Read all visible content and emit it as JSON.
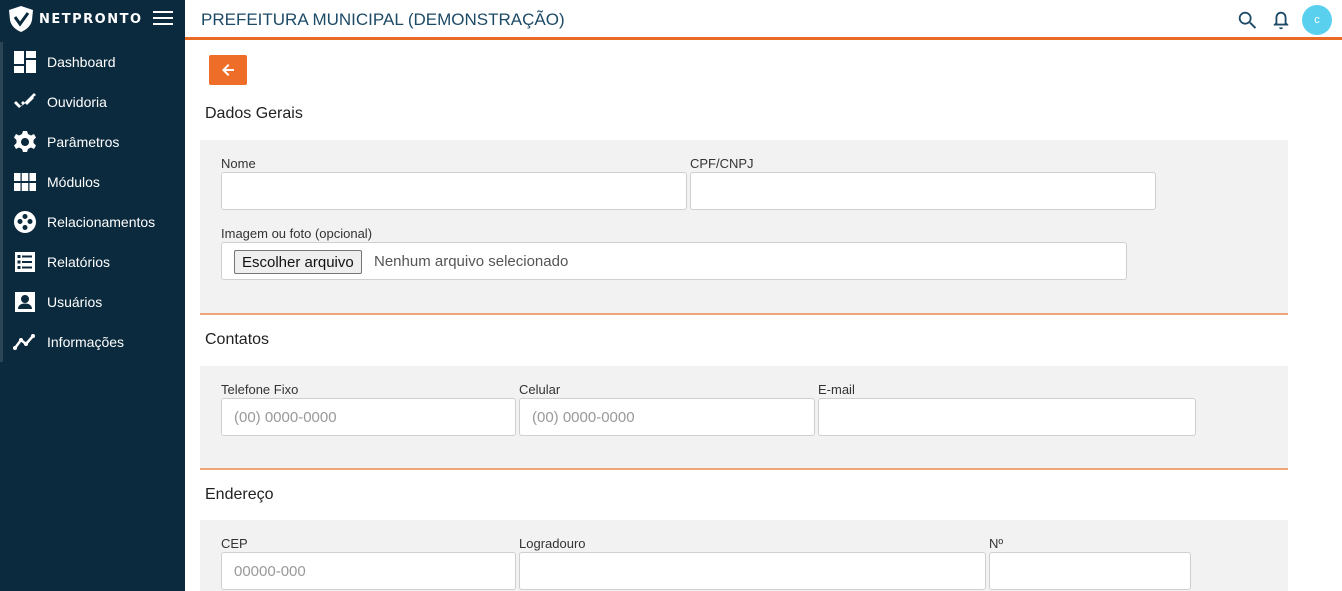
{
  "brand": {
    "name": "NETPRONTO"
  },
  "header": {
    "title": "PREFEITURA MUNICIPAL (DEMONSTRAÇÃO)",
    "avatar_initial": "c"
  },
  "sidebar": {
    "items": [
      {
        "label": "Dashboard",
        "icon": "dashboard-icon"
      },
      {
        "label": "Ouvidoria",
        "icon": "double-check-icon"
      },
      {
        "label": "Parâmetros",
        "icon": "gear-icon"
      },
      {
        "label": "Módulos",
        "icon": "grid-icon"
      },
      {
        "label": "Relacionamentos",
        "icon": "relationships-icon"
      },
      {
        "label": "Relatórios",
        "icon": "list-report-icon"
      },
      {
        "label": "Usuários",
        "icon": "user-box-icon"
      },
      {
        "label": "Informações",
        "icon": "line-chart-icon"
      }
    ]
  },
  "form": {
    "dados_gerais": {
      "title": "Dados Gerais",
      "nome_label": "Nome",
      "nome_value": "",
      "cpf_label": "CPF/CNPJ",
      "cpf_value": "",
      "imagem_label": "Imagem ou foto (opcional)",
      "file_button": "Escolher arquivo",
      "file_status": "Nenhum arquivo selecionado"
    },
    "contatos": {
      "title": "Contatos",
      "telefone_label": "Telefone Fixo",
      "telefone_placeholder": "(00) 0000-0000",
      "celular_label": "Celular",
      "celular_placeholder": "(00) 0000-0000",
      "email_label": "E-mail",
      "email_value": ""
    },
    "endereco": {
      "title": "Endereço",
      "cep_label": "CEP",
      "cep_placeholder": "00000-000",
      "logradouro_label": "Logradouro",
      "logradouro_value": "",
      "numero_label": "Nº",
      "numero_value": ""
    }
  },
  "colors": {
    "sidebar_bg": "#0b2a3d",
    "accent": "#ee6d28",
    "title_text": "#1d4a66",
    "avatar": "#5ad0ef"
  }
}
